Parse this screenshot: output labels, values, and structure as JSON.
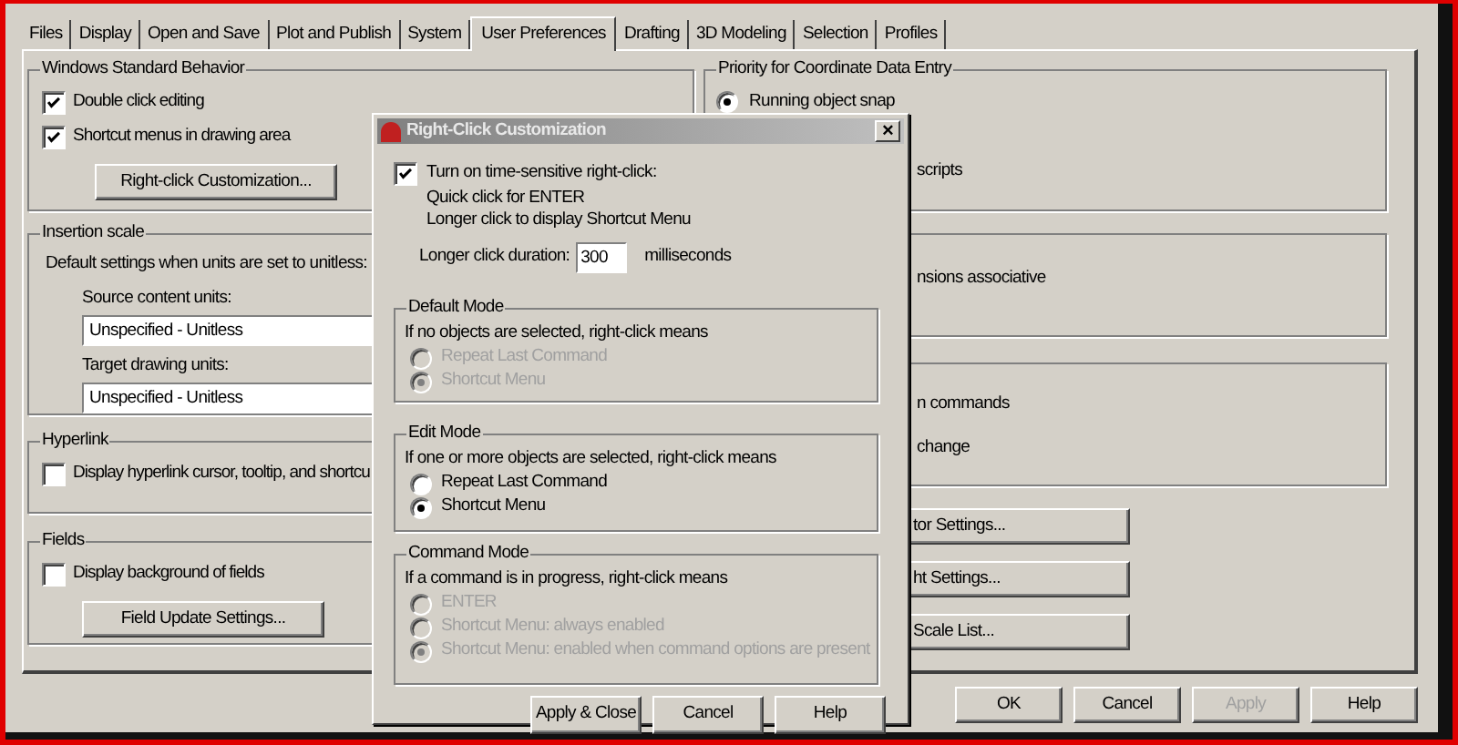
{
  "tabs": [
    {
      "label": "Files",
      "selected": false
    },
    {
      "label": "Display",
      "selected": false
    },
    {
      "label": "Open and Save",
      "selected": false
    },
    {
      "label": "Plot and Publish",
      "selected": false
    },
    {
      "label": "System",
      "selected": false
    },
    {
      "label": "User Preferences",
      "selected": true
    },
    {
      "label": "Drafting",
      "selected": false
    },
    {
      "label": "3D Modeling",
      "selected": false
    },
    {
      "label": "Selection",
      "selected": false
    },
    {
      "label": "Profiles",
      "selected": false
    }
  ],
  "left_groups": [
    {
      "title": "Windows Standard Behavior",
      "items": [
        {
          "kind": "checkbox",
          "label": "Double click editing",
          "checked": true
        },
        {
          "kind": "checkbox",
          "label": "Shortcut menus in drawing area",
          "checked": true
        },
        {
          "kind": "button",
          "label": "Right-click Customization..."
        }
      ]
    },
    {
      "title": "Insertion scale",
      "items": [
        {
          "kind": "text",
          "label": "Default settings when units are set to unitless:"
        },
        {
          "kind": "field",
          "label": "Source content units:",
          "value": "Unspecified - Unitless"
        },
        {
          "kind": "field",
          "label": "Target drawing units:",
          "value": "Unspecified - Unitless"
        }
      ]
    },
    {
      "title": "Hyperlink",
      "items": [
        {
          "kind": "checkbox",
          "label": "Display hyperlink cursor, tooltip, and shortcu",
          "checked": false
        }
      ]
    },
    {
      "title": "Fields",
      "items": [
        {
          "kind": "checkbox",
          "label": "Display background of fields",
          "checked": false
        },
        {
          "kind": "button",
          "label": "Field Update Settings..."
        }
      ]
    }
  ],
  "right_groups": [
    {
      "title": "Priority for Coordinate Data Entry",
      "items": [
        {
          "kind": "radio",
          "label": "Running object snap",
          "selected": true
        },
        {
          "kind": "partial",
          "label": "scripts"
        }
      ]
    },
    {
      "items": [
        {
          "kind": "partial",
          "label": "nsions associative"
        }
      ]
    },
    {
      "items": [
        {
          "kind": "partial",
          "label": "n commands"
        },
        {
          "kind": "partial",
          "label": "change"
        }
      ]
    }
  ],
  "right_buttons": [
    "tor Settings...",
    "ht Settings...",
    "Scale List..."
  ],
  "footer_buttons": [
    {
      "label": "OK",
      "disabled": false
    },
    {
      "label": "Cancel",
      "disabled": false
    },
    {
      "label": "Apply",
      "disabled": true
    },
    {
      "label": "Help",
      "disabled": false
    }
  ],
  "dialog": {
    "title": "Right-Click Customization",
    "close": "×",
    "time_sensitive": {
      "label": "Turn on time-sensitive right-click:",
      "checked": true
    },
    "notes": [
      "Quick click for ENTER",
      "Longer click to display Shortcut Menu"
    ],
    "duration": {
      "label": "Longer click duration:",
      "value": "300",
      "unit": "milliseconds"
    },
    "modes": [
      {
        "title": "Default Mode",
        "description": "If no objects are selected, right-click means",
        "disabled": true,
        "options": [
          {
            "label": "Repeat Last Command",
            "selected": false
          },
          {
            "label": "Shortcut Menu",
            "selected": true
          }
        ]
      },
      {
        "title": "Edit Mode",
        "description": "If one or more objects are selected, right-click means",
        "disabled": false,
        "options": [
          {
            "label": "Repeat Last Command",
            "selected": false
          },
          {
            "label": "Shortcut Menu",
            "selected": true
          }
        ]
      },
      {
        "title": "Command Mode",
        "description": "If a command is in progress, right-click means",
        "disabled": true,
        "options": [
          {
            "label": "ENTER",
            "selected": false
          },
          {
            "label": "Shortcut Menu: always enabled",
            "selected": false
          },
          {
            "label": "Shortcut Menu: enabled when command options are present",
            "selected": true
          }
        ]
      }
    ],
    "buttons": [
      "Apply & Close",
      "Cancel",
      "Help"
    ]
  }
}
